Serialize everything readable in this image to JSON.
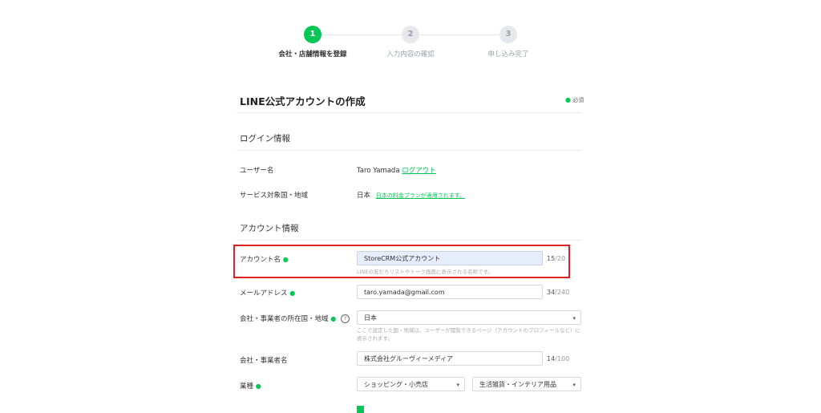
{
  "stepper": {
    "steps": [
      {
        "number": "1",
        "label": "会社・店舗情報を登録"
      },
      {
        "number": "2",
        "label": "入力内容の確認"
      },
      {
        "number": "3",
        "label": "申し込み完了"
      }
    ]
  },
  "page": {
    "title": "LINE公式アカウントの作成",
    "required_legend": "必須"
  },
  "login_section": {
    "title": "ログイン情報",
    "username_label": "ユーザー名",
    "username_value": "Taro Yamada",
    "logout_link": "ログアウト",
    "service_region_label": "サービス対象国・地域",
    "service_region_value": "日本",
    "pricing_link": "日本の料金プランが適用されます。"
  },
  "account_section": {
    "title": "アカウント情報",
    "account_name": {
      "label": "アカウント名",
      "value": "StoreCRM公式アカウント",
      "count": "15",
      "max": "/20",
      "hint": "LINEの友だちリストやトーク画面に表示される名称です。"
    },
    "email": {
      "label": "メールアドレス",
      "value": "taro.yamada@gmail.com",
      "count": "34",
      "max": "/240"
    },
    "country": {
      "label": "会社・事業者の所在国・地域",
      "value": "日本",
      "hint_line1": "ここで設定した国・地域は、ユーザーが閲覧できるページ（アカウントのプロフィールなど）に",
      "hint_line2": "表示されます。"
    },
    "company_name": {
      "label": "会社・事業者名",
      "value": "株式会社グルーヴィーメディア",
      "count": "14",
      "max": "/100"
    },
    "industry": {
      "label": "業種",
      "category_value": "ショッピング・小売店",
      "subcategory_value": "生活雑貨・インテリア用品"
    }
  },
  "colors": {
    "accent": "#06c755",
    "highlight_border": "#e02020"
  },
  "icons": {
    "required_dot": "●",
    "chevron": "▾",
    "help": "?"
  }
}
